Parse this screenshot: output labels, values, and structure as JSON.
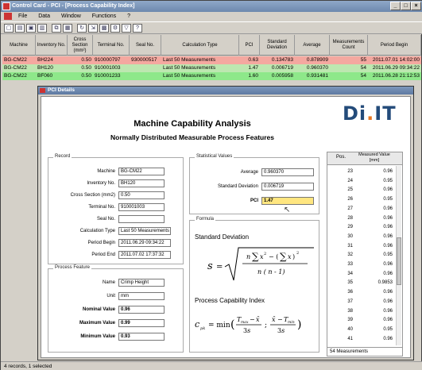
{
  "window": {
    "title": "Control Card - PCI - [Process Capability Index]",
    "minimize_label": "_",
    "maximize_label": "□",
    "close_label": "×"
  },
  "menu": [
    "File",
    "Data",
    "Window",
    "Functions",
    "?"
  ],
  "toolbar_icons": [
    "new-icon",
    "open-icon",
    "save-icon",
    "print-icon",
    "copy-icon",
    "paste-icon",
    "refresh-icon",
    "export-icon",
    "chart-icon",
    "settings-icon",
    "filter-icon",
    "help-icon"
  ],
  "grid": {
    "columns": [
      "Machine",
      "Inventory No.",
      "Cross Section (mm²)",
      "Terminal No.",
      "Seal No.",
      "Calculation Type",
      "PCI",
      "Standard Deviation",
      "Average",
      "Measurements Count",
      "Period Begin"
    ],
    "rows": [
      {
        "machine": "BG-CM22",
        "inventory": "BH224",
        "cross": "0.50",
        "terminal": "910000797",
        "seal": "930000517",
        "calc": "Last 50 Measurements",
        "pci": "0.63",
        "std": "0.134783",
        "avg": "0.878909",
        "count": "55",
        "begin": "2011.07.01 14:02:00",
        "color": "#f4a8a0"
      },
      {
        "machine": "BG-CM22",
        "inventory": "BH120",
        "cross": "0.50",
        "terminal": "910001003",
        "seal": "",
        "calc": "Last 50 Measurements",
        "pci": "1.47",
        "std": "0.006719",
        "avg": "0.960370",
        "count": "54",
        "begin": "2011.06.29 09:34:22",
        "color": "#bde7b0"
      },
      {
        "machine": "BG-CM22",
        "inventory": "BF060",
        "cross": "0.50",
        "terminal": "910001233",
        "seal": "",
        "calc": "Last 50 Measurements",
        "pci": "1.60",
        "std": "0.005958",
        "avg": "0.931481",
        "count": "54",
        "begin": "2011.06.28 21:12:53",
        "color": "#8ee88a"
      }
    ]
  },
  "status": "4 records, 1 selected",
  "dialog": {
    "title": "PCI Details",
    "logo_main": "Di",
    "logo_dot": ".",
    "logo_tail": "IT",
    "heading": "Machine Capability Analysis",
    "subheading": "Normally Distributed Measurable Process Features",
    "record": {
      "group_label": "Record",
      "fields": [
        {
          "label": "Machine",
          "value": "BG-CM22"
        },
        {
          "label": "Inventory No.",
          "value": "BH120"
        },
        {
          "label": "Cross Section (mm2)",
          "value": "0.50"
        },
        {
          "label": "Terminal No.",
          "value": "910001003"
        },
        {
          "label": "Seal No.",
          "value": ""
        },
        {
          "label": "Calculation Type",
          "value": "Last 50 Measurements"
        },
        {
          "label": "Period Begin",
          "value": "2011.06.29 09:34:22"
        },
        {
          "label": "Period End",
          "value": "2011.07.02 17:37:32"
        }
      ]
    },
    "process_feature": {
      "group_label": "Process Feature",
      "name_label": "Name",
      "name_value": "Crimp Height",
      "unit_label": "Unit",
      "unit_value": "mm",
      "nominal_label": "Nominal Value",
      "nominal_value": "0.96",
      "max_label": "Maximum Value",
      "max_value": "0.99",
      "min_label": "Minimum Value",
      "min_value": "0.93"
    },
    "stats": {
      "group_label": "Statistical Values",
      "average_label": "Average",
      "average_value": "0.960370",
      "std_label": "Standard Deviation",
      "std_value": "0.006719",
      "pci_label": "PCI",
      "pci_value": "1.47"
    },
    "formula": {
      "group_label": "Formula",
      "std_title": "Standard Deviation",
      "pci_title": "Process Capability Index"
    },
    "measurements": {
      "col_pos": "Pos.",
      "col_value": "Measured Value [mm]",
      "rows": [
        {
          "pos": "23",
          "value": "0.96"
        },
        {
          "pos": "24",
          "value": "0.95"
        },
        {
          "pos": "25",
          "value": "0.96"
        },
        {
          "pos": "26",
          "value": "0.95"
        },
        {
          "pos": "27",
          "value": "0.96"
        },
        {
          "pos": "28",
          "value": "0.96"
        },
        {
          "pos": "29",
          "value": "0.96"
        },
        {
          "pos": "30",
          "value": "0.96"
        },
        {
          "pos": "31",
          "value": "0.96"
        },
        {
          "pos": "32",
          "value": "0.95"
        },
        {
          "pos": "33",
          "value": "0.96"
        },
        {
          "pos": "34",
          "value": "0.96"
        },
        {
          "pos": "35",
          "value": "0.9853"
        },
        {
          "pos": "36",
          "value": "0.96"
        },
        {
          "pos": "37",
          "value": "0.96"
        },
        {
          "pos": "38",
          "value": "0.96"
        },
        {
          "pos": "39",
          "value": "0.96"
        },
        {
          "pos": "40",
          "value": "0.95"
        },
        {
          "pos": "41",
          "value": "0.96"
        }
      ],
      "count_label": "54 Measurements"
    }
  }
}
